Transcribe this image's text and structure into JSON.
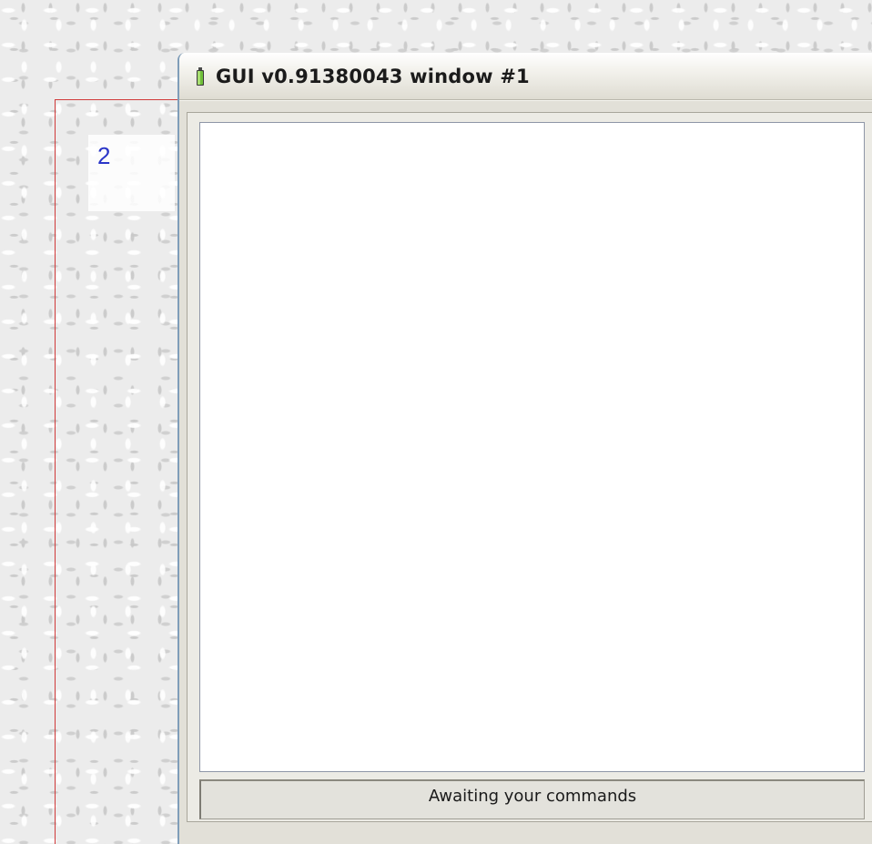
{
  "overlay": {
    "label_number": "2"
  },
  "window": {
    "title": "GUI v0.91380043 window #1",
    "status_text": "Awaiting your commands",
    "colors": {
      "frame_outline": "#d03a3a",
      "label_number": "#2a35c8",
      "canvas_background": "#ffffff"
    },
    "icons": {
      "title_icon": "green-battery-icon"
    }
  }
}
